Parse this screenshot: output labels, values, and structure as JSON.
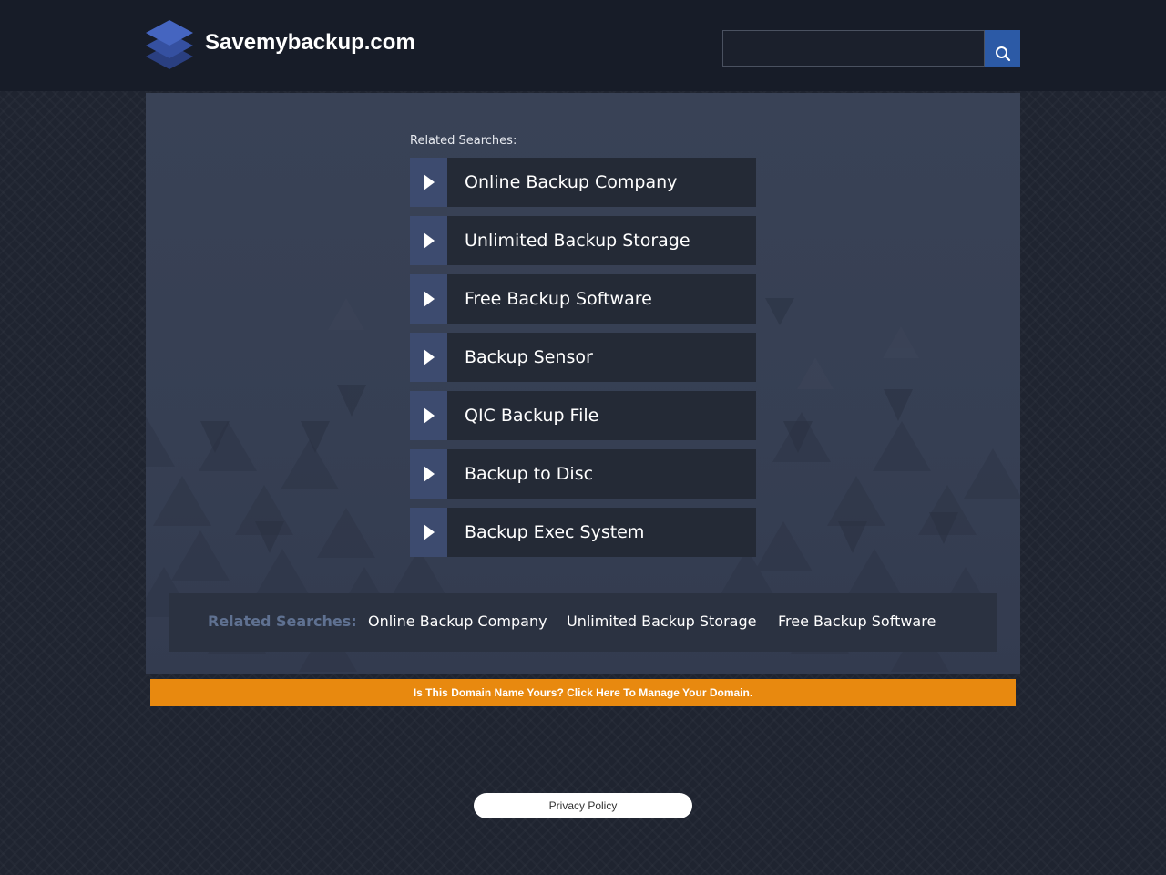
{
  "header": {
    "site_title": "Savemybackup.com",
    "search": {
      "value": "",
      "placeholder": ""
    }
  },
  "main": {
    "related_heading": "Related Searches:",
    "links": [
      {
        "label": "Online Backup Company"
      },
      {
        "label": "Unlimited Backup Storage"
      },
      {
        "label": "Free Backup Software"
      },
      {
        "label": "Backup Sensor"
      },
      {
        "label": "QIC Backup File"
      },
      {
        "label": "Backup to Disc"
      },
      {
        "label": "Backup Exec System"
      }
    ]
  },
  "bottom_bar": {
    "heading": "Related Searches:",
    "links": [
      {
        "label": "Online Backup Company"
      },
      {
        "label": "Unlimited Backup Storage"
      },
      {
        "label": "Free Backup Software"
      }
    ]
  },
  "domain_banner": {
    "text": "Is This Domain Name Yours? Click Here To Manage Your Domain."
  },
  "footer": {
    "privacy_label": "Privacy Policy"
  },
  "colors": {
    "accent_blue": "#2c5aa6",
    "banner_orange": "#e8890f",
    "arrow_block": "#3d4b6f",
    "link_block": "#242a36"
  },
  "icons": {
    "logo": "stacked-layers-icon",
    "search": "search-icon",
    "link_arrow": "play-arrow-icon"
  }
}
